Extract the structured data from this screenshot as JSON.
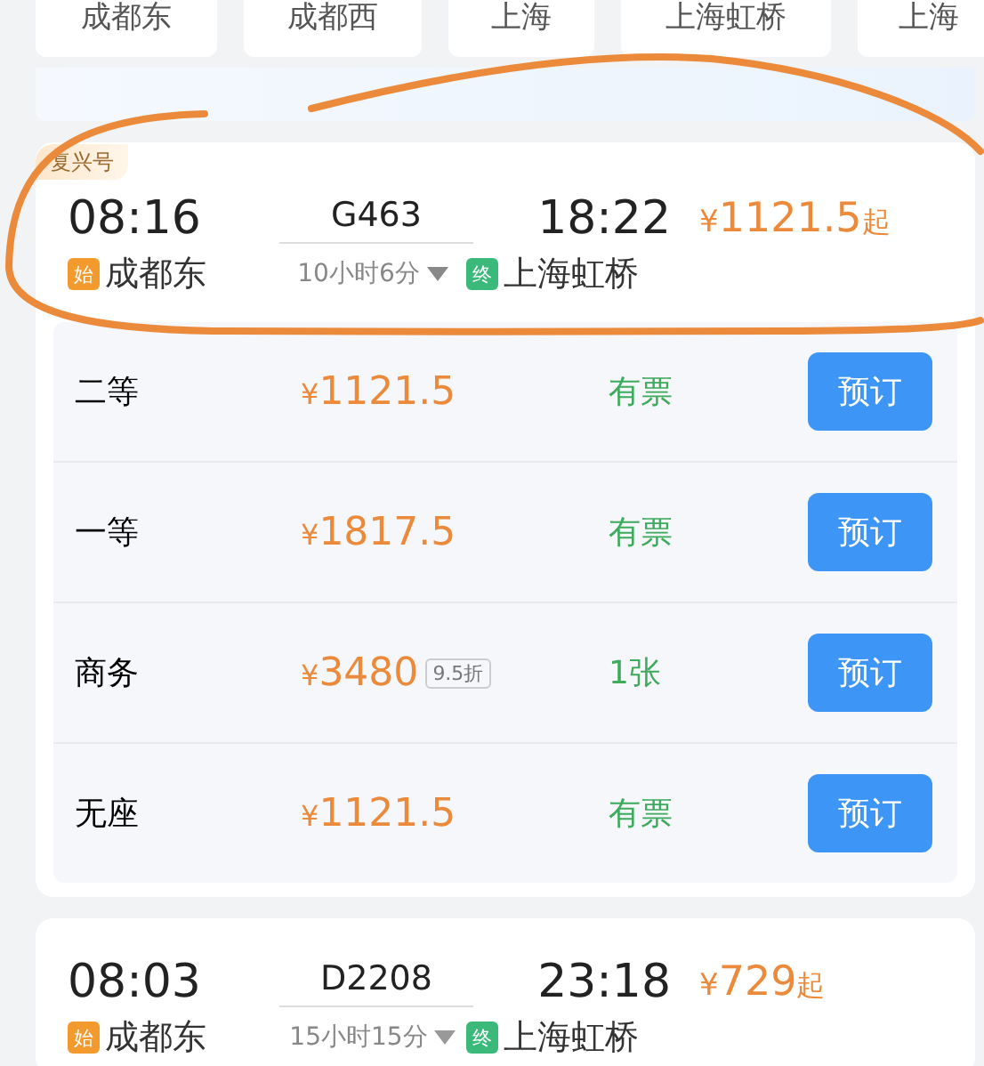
{
  "station_filters": [
    {
      "label": "成都东"
    },
    {
      "label": "成都西"
    },
    {
      "label": "上海"
    },
    {
      "label": "上海虹桥"
    },
    {
      "label": "上海"
    }
  ],
  "trains": [
    {
      "tag": "复兴号",
      "depart_time": "08:16",
      "train_no": "G463",
      "duration": "10小时6分",
      "arrive_time": "18:22",
      "from_badge": "始",
      "from": "成都东",
      "to_badge": "终",
      "to": "上海虹桥",
      "price": "¥1121.5",
      "price_suffix": "起",
      "expanded": true,
      "seats": [
        {
          "name": "二等",
          "price": "¥1121.5",
          "availability": "有票",
          "button": "预订"
        },
        {
          "name": "一等",
          "price": "¥1817.5",
          "availability": "有票",
          "button": "预订"
        },
        {
          "name": "商务",
          "price": "¥3480",
          "discount": "9.5折",
          "availability": "1张",
          "button": "预订"
        },
        {
          "name": "无座",
          "price": "¥1121.5",
          "availability": "有票",
          "button": "预订"
        }
      ]
    },
    {
      "depart_time": "08:03",
      "train_no": "D2208",
      "duration": "15小时15分",
      "arrive_time": "23:18",
      "from_badge": "始",
      "from": "成都东",
      "to_badge": "终",
      "to": "上海虹桥",
      "price": "¥729",
      "price_suffix": "起",
      "expanded": false
    }
  ]
}
